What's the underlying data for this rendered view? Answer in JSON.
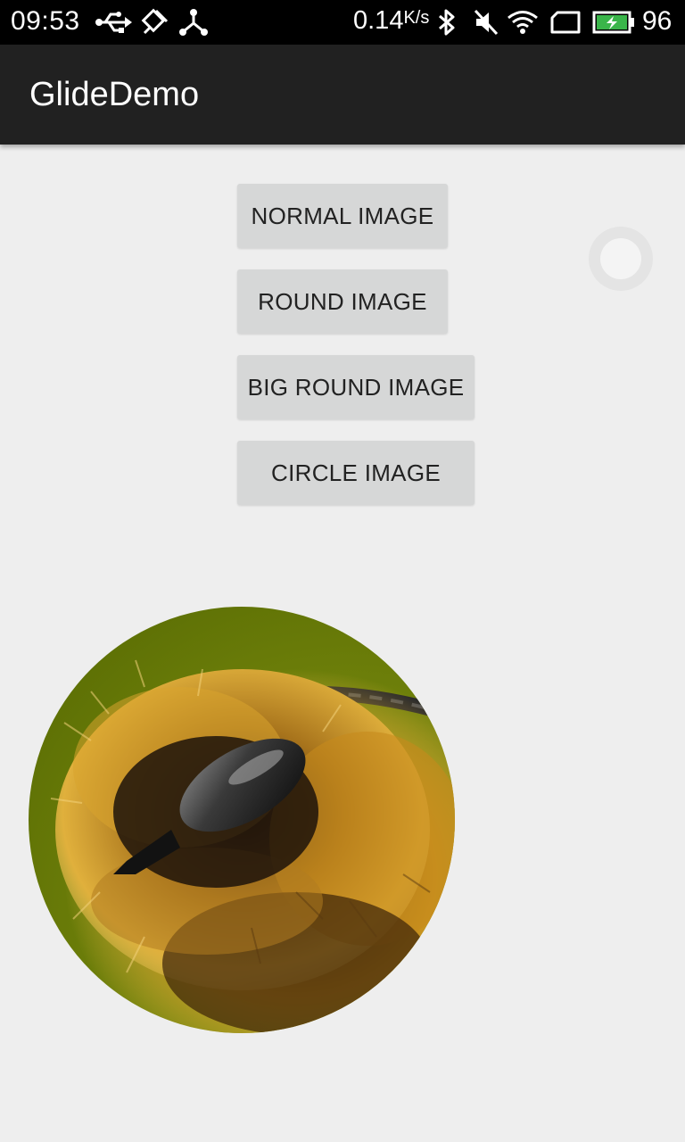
{
  "status_bar": {
    "time": "09:53",
    "net_speed": "0.14",
    "net_speed_unit": "K/s",
    "battery_level": "96",
    "icons": [
      "usb-icon",
      "debug-icon",
      "share-icon",
      "bluetooth-icon",
      "mute-icon",
      "wifi-icon",
      "sim-icon",
      "battery-icon"
    ],
    "battery_color": "#3ab54a"
  },
  "app_bar": {
    "title": "GlideDemo"
  },
  "buttons": {
    "normal_label": "NORMAL IMAGE",
    "round_label": "ROUND IMAGE",
    "big_round_label": "BIG ROUND IMAGE",
    "circle_label": "CIRCLE IMAGE"
  },
  "colors": {
    "background": "#eeeeee",
    "app_bar": "#212121",
    "button": "#d6d7d7"
  }
}
